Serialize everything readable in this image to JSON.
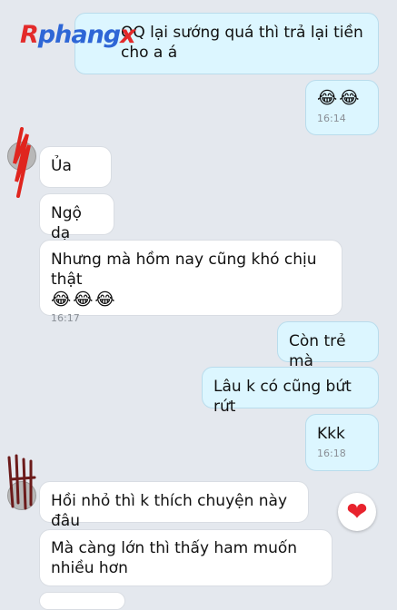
{
  "watermark": {
    "first_letter": "R",
    "rest": "phang",
    "tail": "x"
  },
  "messages": [
    {
      "id": "m1",
      "side": "out",
      "text": "QQ lại sướng quá thì trả lại tiền cho a á",
      "time": ""
    },
    {
      "id": "m2",
      "side": "out",
      "text": "😂😂",
      "time": "16:14"
    },
    {
      "id": "m3",
      "side": "in",
      "text": "Ủa",
      "time": ""
    },
    {
      "id": "m4",
      "side": "in",
      "text": "Ngộ dạ",
      "time": ""
    },
    {
      "id": "m5",
      "side": "in",
      "text": "Nhưng mà hồm nay cũng khó chịu thật",
      "emoji": "😂😂😂",
      "time": "16:17"
    },
    {
      "id": "m6",
      "side": "out",
      "text": "Còn trẻ mà",
      "time": ""
    },
    {
      "id": "m7",
      "side": "out",
      "text": "Lâu k có cũng bứt rứt",
      "time": ""
    },
    {
      "id": "m8",
      "side": "out",
      "text": "Kkk",
      "time": "16:18"
    },
    {
      "id": "m9",
      "side": "in",
      "text": "Hồi nhỏ thì k thích chuyện này đâu",
      "time": ""
    },
    {
      "id": "m10",
      "side": "in",
      "text": "Mà càng lớn thì thấy ham muốn nhiều hơn",
      "time": ""
    }
  ],
  "reaction": {
    "icon": "heart-icon",
    "glyph": "❤",
    "color": "#e8232d"
  },
  "colors": {
    "incoming": "#ffffff",
    "outgoing": "#dcf6ff",
    "background": "#e4e8ee"
  }
}
